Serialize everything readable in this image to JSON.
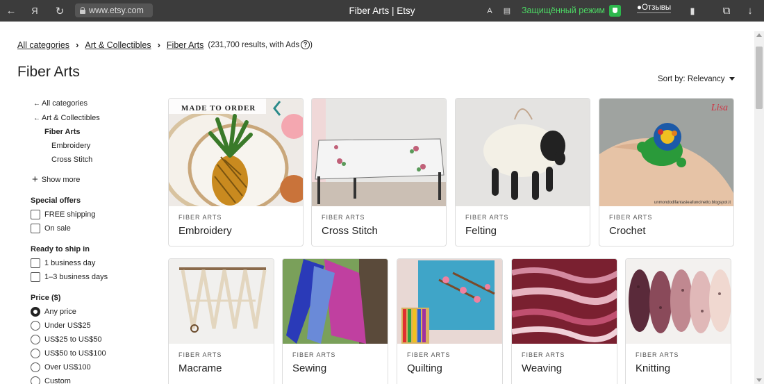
{
  "browser": {
    "url": "www.etsy.com",
    "tab_title": "Fiber Arts | Etsy",
    "protected_mode": "Защищённый режим",
    "reviews": "Отзывы"
  },
  "breadcrumb": {
    "items": [
      "All categories",
      "Art & Collectibles",
      "Fiber Arts"
    ],
    "results": "(231,700 results, with Ads"
  },
  "page_title": "Fiber Arts",
  "sort_label": "Sort by: Relevancy",
  "sidebar": {
    "nav": {
      "all_categories": "All categories",
      "art_collectibles": "Art & Collectibles",
      "current": "Fiber Arts",
      "children": [
        "Embroidery",
        "Cross Stitch"
      ],
      "show_more": "Show more"
    },
    "special_offers": {
      "title": "Special offers",
      "options": [
        "FREE shipping",
        "On sale"
      ]
    },
    "ready_to_ship": {
      "title": "Ready to ship in",
      "options": [
        "1 business day",
        "1–3 business days"
      ]
    },
    "price": {
      "title": "Price ($)",
      "options": [
        "Any price",
        "Under US$25",
        "US$25 to US$50",
        "US$50 to US$100",
        "Over US$100",
        "Custom"
      ],
      "selected": "Any price"
    }
  },
  "cards_row1": [
    {
      "category": "FIBER ARTS",
      "name": "Embroidery",
      "img_overlay": "MADE TO ORDER"
    },
    {
      "category": "FIBER ARTS",
      "name": "Cross Stitch"
    },
    {
      "category": "FIBER ARTS",
      "name": "Felting"
    },
    {
      "category": "FIBER ARTS",
      "name": "Crochet",
      "img_overlay": "Lisa",
      "img_caption": "unmondodifantasiealluncinetto.blogspot.it"
    }
  ],
  "cards_row2": [
    {
      "category": "FIBER ARTS",
      "name": "Macrame"
    },
    {
      "category": "FIBER ARTS",
      "name": "Sewing"
    },
    {
      "category": "FIBER ARTS",
      "name": "Quilting"
    },
    {
      "category": "FIBER ARTS",
      "name": "Weaving"
    },
    {
      "category": "FIBER ARTS",
      "name": "Knitting"
    }
  ],
  "colors": {
    "browser_bar": "#3c3c3c",
    "protect_green": "#4cd964"
  }
}
